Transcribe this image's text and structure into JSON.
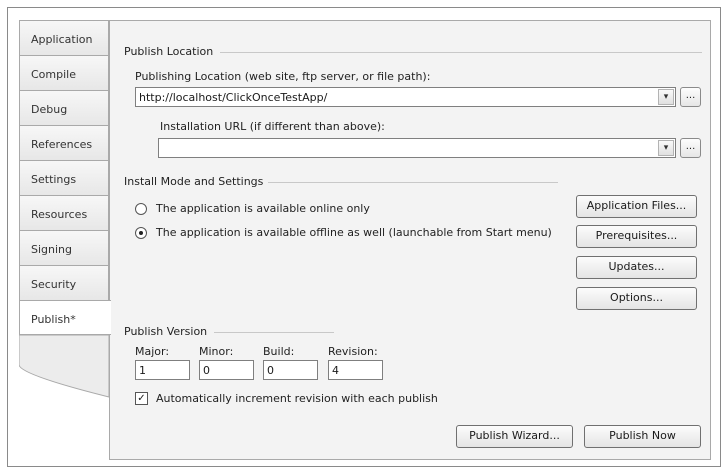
{
  "tabs": [
    {
      "label": "Application",
      "active": false
    },
    {
      "label": "Compile",
      "active": false
    },
    {
      "label": "Debug",
      "active": false
    },
    {
      "label": "References",
      "active": false
    },
    {
      "label": "Settings",
      "active": false
    },
    {
      "label": "Resources",
      "active": false
    },
    {
      "label": "Signing",
      "active": false
    },
    {
      "label": "Security",
      "active": false
    },
    {
      "label": "Publish*",
      "active": true
    }
  ],
  "publish_location": {
    "group_title": "Publish Location",
    "publishing_label": "Publishing Location (web site, ftp server, or file path):",
    "publishing_value": "http://localhost/ClickOnceTestApp/",
    "install_label": "Installation URL (if different than above):",
    "install_value": "",
    "browse_label": "..."
  },
  "install_mode": {
    "group_title": "Install Mode and Settings",
    "options": [
      {
        "label": "The application is available online only",
        "selected": false
      },
      {
        "label": "The application is available offline as well (launchable from Start menu)",
        "selected": true
      }
    ],
    "buttons": {
      "application_files": "Application Files...",
      "prerequisites": "Prerequisites...",
      "updates": "Updates...",
      "options": "Options..."
    }
  },
  "publish_version": {
    "group_title": "Publish Version",
    "fields": [
      {
        "label": "Major:",
        "value": "1"
      },
      {
        "label": "Minor:",
        "value": "0"
      },
      {
        "label": "Build:",
        "value": "0"
      },
      {
        "label": "Revision:",
        "value": "4"
      }
    ],
    "auto_increment_label": "Automatically increment revision with each publish",
    "auto_increment_checked": true
  },
  "actions": {
    "publish_wizard": "Publish Wizard...",
    "publish_now": "Publish Now"
  },
  "icons": {
    "dropdown": "chevron-down-icon",
    "check": "check-icon"
  }
}
